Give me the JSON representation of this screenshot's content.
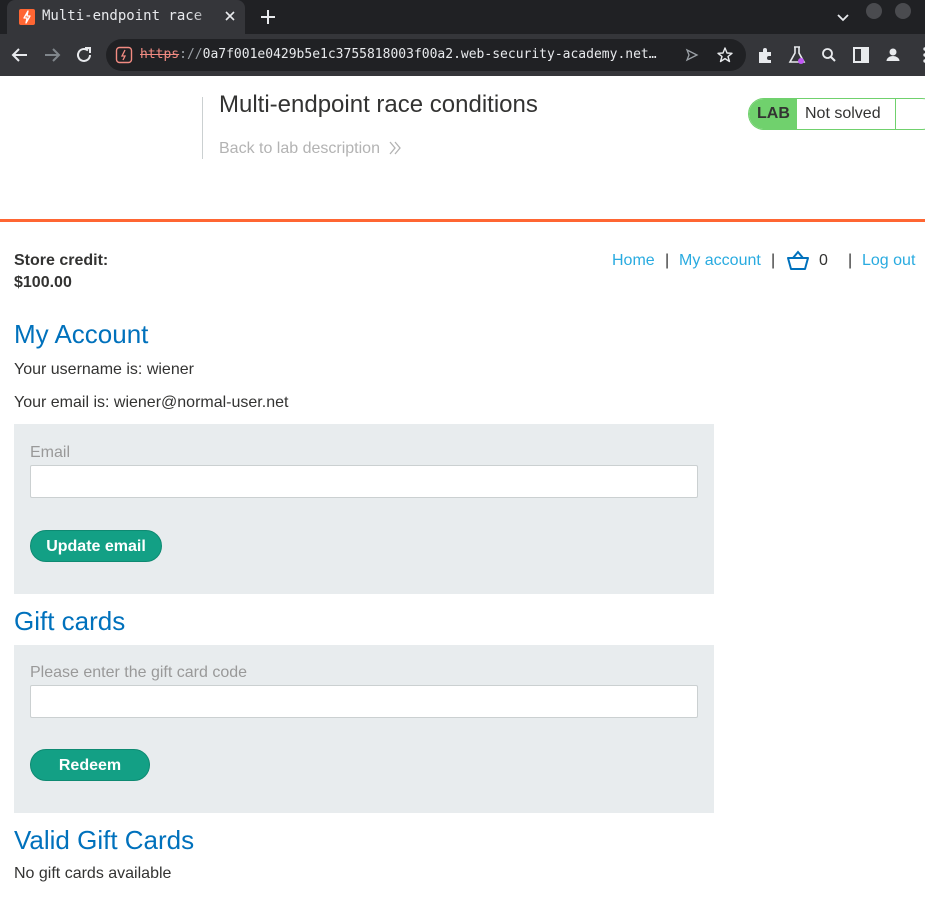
{
  "browser": {
    "tab_title": "Multi-endpoint race conditions",
    "url_scheme": "https",
    "url_separator": "://",
    "url_rest": "0a7f001e0429b5e1c3755818003f00a2.web-security-academy.net…"
  },
  "lab": {
    "title": "Multi-endpoint race conditions",
    "back_link": "Back to lab description",
    "badge_label": "LAB",
    "status": "Not solved"
  },
  "account": {
    "store_credit_label": "Store credit:",
    "store_credit_value": "$100.00"
  },
  "nav": {
    "home": "Home",
    "separator": "|",
    "my_account": "My account",
    "cart_count": "0",
    "log_out": "Log out"
  },
  "my_account": {
    "heading": "My Account",
    "username_line": "Your username is: wiener",
    "email_line": "Your email is: wiener@normal-user.net",
    "email_label": "Email",
    "email_value": "",
    "update_button": "Update email"
  },
  "gift_cards": {
    "heading": "Gift cards",
    "code_label": "Please enter the gift card code",
    "code_value": "",
    "redeem_button": "Redeem"
  },
  "valid_gift_cards": {
    "heading": "Valid Gift Cards",
    "empty_text": "No gift cards available"
  },
  "colors": {
    "accent_orange": "#ff6633",
    "link_blue": "#29abe0",
    "heading_blue": "#0071bc",
    "button_green": "#13a085",
    "badge_green": "#70d16d",
    "panel_grey": "#e8ecee"
  }
}
